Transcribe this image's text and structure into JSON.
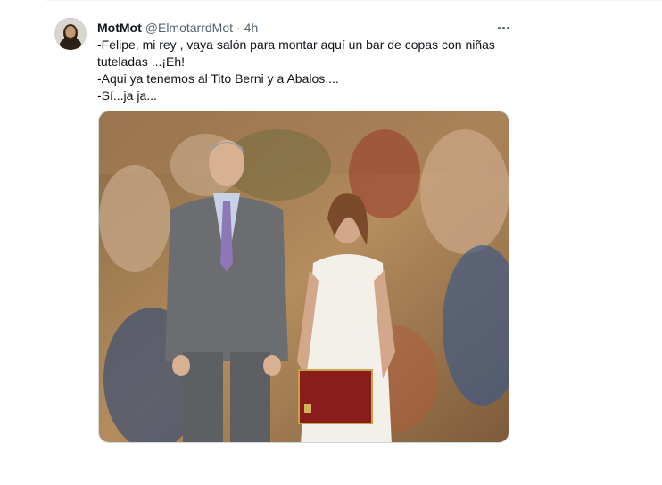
{
  "tweet": {
    "author_name": "MotMot",
    "author_handle": "@ElmotarrdMot",
    "separator": "·",
    "time": "4h",
    "text_lines": [
      "-Felipe, mi rey , vaya salón para montar aquí un bar de copas con niñas",
      "tuteladas ...¡Eh!",
      "-Aqui ya tenemos al Tito Berni y a Abalos....",
      "-Sí...ja ja..."
    ],
    "more_icon": "more-horizontal-icon",
    "media_description_icon": "photo"
  }
}
